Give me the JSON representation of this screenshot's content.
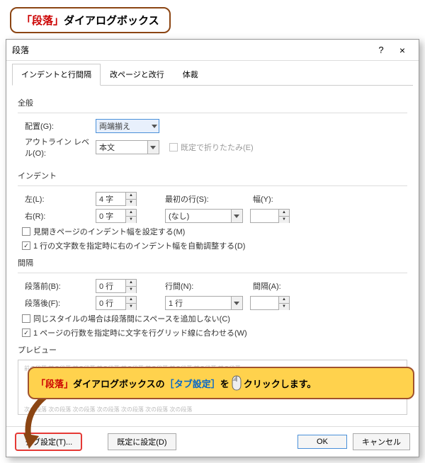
{
  "callout_top": {
    "open": "「",
    "word": "段落",
    "close": "」",
    "rest": "ダイアログボックス"
  },
  "titlebar": {
    "title": "段落",
    "help": "?",
    "close": "×"
  },
  "tabs": {
    "t1": "インデントと行間隔",
    "t2": "改ページと改行",
    "t3": "体裁"
  },
  "general": {
    "heading": "全般",
    "align_label": "配置(G):",
    "align_value": "両端揃え",
    "outline_label": "アウトライン レベル(O):",
    "outline_value": "本文",
    "collapse_label": "既定で折りたたみ(E)"
  },
  "indent": {
    "heading": "インデント",
    "left_label": "左(L):",
    "left_value": "4 字",
    "right_label": "右(R):",
    "right_value": "0 字",
    "first_label": "最初の行(S):",
    "first_value": "(なし)",
    "width_label": "幅(Y):",
    "width_value": "",
    "cb1": "見開きページのインデント幅を設定する(M)",
    "cb2": "1 行の文字数を指定時に右のインデント幅を自動調整する(D)"
  },
  "spacing": {
    "heading": "間隔",
    "before_label": "段落前(B):",
    "before_value": "0 行",
    "after_label": "段落後(F):",
    "after_value": "0 行",
    "line_label": "行間(N):",
    "line_value": "1 行",
    "space_label": "間隔(A):",
    "space_value": "",
    "cb1": "同じスタイルの場合は段落間にスペースを追加しない(C)",
    "cb2": "1 ページの行数を指定時に文字を行グリッド線に合わせる(W)"
  },
  "preview": {
    "heading": "プレビュー",
    "gray1": "前の段落 前の段落 前の段落 前の段落 前の段落 前の段落 前の段落 前の段落 前の段落",
    "gray2": "次の段落 次の段落 次の段落 次の段落 次の段落 次の段落 次の段落"
  },
  "callout_yellow": {
    "p1": "「",
    "p2": "段落",
    "p3": "」",
    "p4": "ダイアログボックスの",
    "p5": "［",
    "p6": "タブ設定",
    "p7": "］",
    "p8": "を",
    "p9": "クリックします。"
  },
  "buttons": {
    "tab": "タブ設定(T)...",
    "default": "既定に設定(D)",
    "ok": "OK",
    "cancel": "キャンセル"
  }
}
